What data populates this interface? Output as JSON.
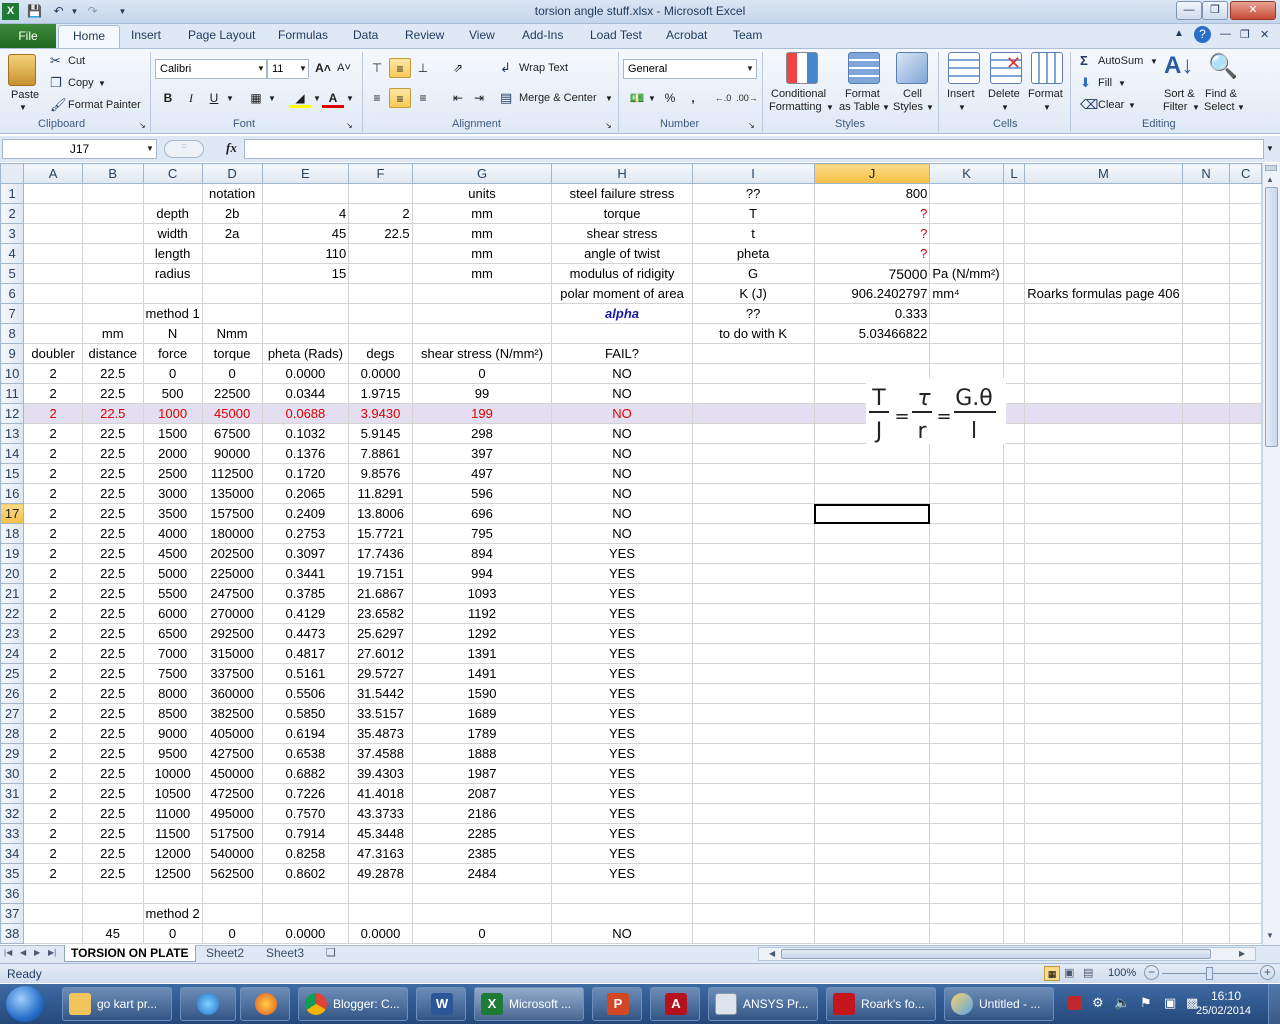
{
  "window": {
    "title": "torsion angle stuff.xlsx - Microsoft Excel"
  },
  "ribbon": {
    "file_tab": "File",
    "tabs": [
      "Home",
      "Insert",
      "Page Layout",
      "Formulas",
      "Data",
      "Review",
      "View",
      "Add-Ins",
      "Load Test",
      "Acrobat",
      "Team"
    ],
    "clipboard": {
      "paste": "Paste",
      "cut": "Cut",
      "copy": "Copy",
      "format_painter": "Format Painter",
      "label": "Clipboard"
    },
    "font": {
      "name": "Calibri",
      "size": "11",
      "label": "Font",
      "bold": "B",
      "italic": "I",
      "underline": "U"
    },
    "alignment": {
      "wrap_text": "Wrap Text",
      "merge_center": "Merge & Center",
      "label": "Alignment"
    },
    "number": {
      "format": "General",
      "label": "Number",
      "percent": "%",
      "comma": ","
    },
    "styles": {
      "conditional": "Conditional",
      "formatting": "Formatting",
      "format": "Format",
      "as_table": "as Table",
      "cell": "Cell",
      "cell_styles": "Styles",
      "label": "Styles"
    },
    "cells": {
      "insert": "Insert",
      "delete": "Delete",
      "format": "Format",
      "label": "Cells"
    },
    "editing": {
      "autosum": "AutoSum",
      "fill": "Fill",
      "clear": "Clear",
      "sort": "Sort &",
      "filter": "Filter",
      "find": "Find &",
      "select": "Select",
      "label": "Editing"
    }
  },
  "formula_bar": {
    "name_box": "J17",
    "fx": "fx",
    "content": ""
  },
  "columns": [
    "A",
    "B",
    "C",
    "D",
    "E",
    "F",
    "G",
    "H",
    "I",
    "J",
    "K",
    "L",
    "M",
    "N",
    "C"
  ],
  "selected_column": "J",
  "selected_row": "17",
  "highlight_row": 12,
  "rows": [
    {
      "n": "1",
      "cells": {
        "D": "notation",
        "G": "units",
        "H": "steel failure stress",
        "I": "??",
        "J": "800"
      }
    },
    {
      "n": "2",
      "cells": {
        "C": "depth",
        "D": "2b",
        "E": "4",
        "F": "2",
        "G": "mm",
        "H": "torque",
        "I": "T",
        "J": "?"
      }
    },
    {
      "n": "3",
      "cells": {
        "C": "width",
        "D": "2a",
        "E": "45",
        "F": "22.5",
        "G": "mm",
        "H": "shear stress",
        "I": "t",
        "J": "?"
      }
    },
    {
      "n": "4",
      "cells": {
        "C": "length",
        "E": "110",
        "G": "mm",
        "H": "angle of twist",
        "I": "pheta",
        "J": "?"
      }
    },
    {
      "n": "5",
      "cells": {
        "C": "radius",
        "E": "15",
        "G": "mm",
        "H": "modulus of ridigity",
        "I": "G",
        "J": "75000",
        "K": "Pa (N/mm²)"
      }
    },
    {
      "n": "6",
      "cells": {
        "H": "polar  moment of area",
        "I": "K (J)",
        "J": "906.2402797",
        "K": "mm⁴",
        "M": "Roarks formulas page 406"
      }
    },
    {
      "n": "7",
      "cells": {
        "C": "method 1",
        "H": "alpha",
        "I": "??",
        "J": "0.333"
      }
    },
    {
      "n": "8",
      "cells": {
        "B": "mm",
        "C": "N",
        "D": "Nmm",
        "I": "to do with K",
        "J": "5.03466822"
      }
    },
    {
      "n": "9",
      "cells": {
        "A": "doubler",
        "B": "distance",
        "C": "force",
        "D": "torque",
        "E": "pheta (Rads)",
        "F": "degs",
        "G": "shear stress (N/mm²)",
        "H": "FAIL?"
      }
    },
    {
      "n": "10",
      "cells": {
        "A": "2",
        "B": "22.5",
        "C": "0",
        "D": "0",
        "E": "0.0000",
        "F": "0.0000",
        "G": "0",
        "H": "NO"
      }
    },
    {
      "n": "11",
      "cells": {
        "A": "2",
        "B": "22.5",
        "C": "500",
        "D": "22500",
        "E": "0.0344",
        "F": "1.9715",
        "G": "99",
        "H": "NO"
      }
    },
    {
      "n": "12",
      "cells": {
        "A": "2",
        "B": "22.5",
        "C": "1000",
        "D": "45000",
        "E": "0.0688",
        "F": "3.9430",
        "G": "199",
        "H": "NO"
      }
    },
    {
      "n": "13",
      "cells": {
        "A": "2",
        "B": "22.5",
        "C": "1500",
        "D": "67500",
        "E": "0.1032",
        "F": "5.9145",
        "G": "298",
        "H": "NO"
      }
    },
    {
      "n": "14",
      "cells": {
        "A": "2",
        "B": "22.5",
        "C": "2000",
        "D": "90000",
        "E": "0.1376",
        "F": "7.8861",
        "G": "397",
        "H": "NO"
      }
    },
    {
      "n": "15",
      "cells": {
        "A": "2",
        "B": "22.5",
        "C": "2500",
        "D": "112500",
        "E": "0.1720",
        "F": "9.8576",
        "G": "497",
        "H": "NO"
      }
    },
    {
      "n": "16",
      "cells": {
        "A": "2",
        "B": "22.5",
        "C": "3000",
        "D": "135000",
        "E": "0.2065",
        "F": "11.8291",
        "G": "596",
        "H": "NO"
      }
    },
    {
      "n": "17",
      "cells": {
        "A": "2",
        "B": "22.5",
        "C": "3500",
        "D": "157500",
        "E": "0.2409",
        "F": "13.8006",
        "G": "696",
        "H": "NO"
      }
    },
    {
      "n": "18",
      "cells": {
        "A": "2",
        "B": "22.5",
        "C": "4000",
        "D": "180000",
        "E": "0.2753",
        "F": "15.7721",
        "G": "795",
        "H": "NO"
      }
    },
    {
      "n": "19",
      "cells": {
        "A": "2",
        "B": "22.5",
        "C": "4500",
        "D": "202500",
        "E": "0.3097",
        "F": "17.7436",
        "G": "894",
        "H": "YES"
      }
    },
    {
      "n": "20",
      "cells": {
        "A": "2",
        "B": "22.5",
        "C": "5000",
        "D": "225000",
        "E": "0.3441",
        "F": "19.7151",
        "G": "994",
        "H": "YES"
      }
    },
    {
      "n": "21",
      "cells": {
        "A": "2",
        "B": "22.5",
        "C": "5500",
        "D": "247500",
        "E": "0.3785",
        "F": "21.6867",
        "G": "1093",
        "H": "YES"
      }
    },
    {
      "n": "22",
      "cells": {
        "A": "2",
        "B": "22.5",
        "C": "6000",
        "D": "270000",
        "E": "0.4129",
        "F": "23.6582",
        "G": "1192",
        "H": "YES"
      }
    },
    {
      "n": "23",
      "cells": {
        "A": "2",
        "B": "22.5",
        "C": "6500",
        "D": "292500",
        "E": "0.4473",
        "F": "25.6297",
        "G": "1292",
        "H": "YES"
      }
    },
    {
      "n": "24",
      "cells": {
        "A": "2",
        "B": "22.5",
        "C": "7000",
        "D": "315000",
        "E": "0.4817",
        "F": "27.6012",
        "G": "1391",
        "H": "YES"
      }
    },
    {
      "n": "25",
      "cells": {
        "A": "2",
        "B": "22.5",
        "C": "7500",
        "D": "337500",
        "E": "0.5161",
        "F": "29.5727",
        "G": "1491",
        "H": "YES"
      }
    },
    {
      "n": "26",
      "cells": {
        "A": "2",
        "B": "22.5",
        "C": "8000",
        "D": "360000",
        "E": "0.5506",
        "F": "31.5442",
        "G": "1590",
        "H": "YES"
      }
    },
    {
      "n": "27",
      "cells": {
        "A": "2",
        "B": "22.5",
        "C": "8500",
        "D": "382500",
        "E": "0.5850",
        "F": "33.5157",
        "G": "1689",
        "H": "YES"
      }
    },
    {
      "n": "28",
      "cells": {
        "A": "2",
        "B": "22.5",
        "C": "9000",
        "D": "405000",
        "E": "0.6194",
        "F": "35.4873",
        "G": "1789",
        "H": "YES"
      }
    },
    {
      "n": "29",
      "cells": {
        "A": "2",
        "B": "22.5",
        "C": "9500",
        "D": "427500",
        "E": "0.6538",
        "F": "37.4588",
        "G": "1888",
        "H": "YES"
      }
    },
    {
      "n": "30",
      "cells": {
        "A": "2",
        "B": "22.5",
        "C": "10000",
        "D": "450000",
        "E": "0.6882",
        "F": "39.4303",
        "G": "1987",
        "H": "YES"
      }
    },
    {
      "n": "31",
      "cells": {
        "A": "2",
        "B": "22.5",
        "C": "10500",
        "D": "472500",
        "E": "0.7226",
        "F": "41.4018",
        "G": "2087",
        "H": "YES"
      }
    },
    {
      "n": "32",
      "cells": {
        "A": "2",
        "B": "22.5",
        "C": "11000",
        "D": "495000",
        "E": "0.7570",
        "F": "43.3733",
        "G": "2186",
        "H": "YES"
      }
    },
    {
      "n": "33",
      "cells": {
        "A": "2",
        "B": "22.5",
        "C": "11500",
        "D": "517500",
        "E": "0.7914",
        "F": "45.3448",
        "G": "2285",
        "H": "YES"
      }
    },
    {
      "n": "34",
      "cells": {
        "A": "2",
        "B": "22.5",
        "C": "12000",
        "D": "540000",
        "E": "0.8258",
        "F": "47.3163",
        "G": "2385",
        "H": "YES"
      }
    },
    {
      "n": "35",
      "cells": {
        "A": "2",
        "B": "22.5",
        "C": "12500",
        "D": "562500",
        "E": "0.8602",
        "F": "49.2878",
        "G": "2484",
        "H": "YES"
      }
    },
    {
      "n": "36",
      "cells": {}
    },
    {
      "n": "37",
      "cells": {
        "C": "method 2"
      }
    },
    {
      "n": "38",
      "cells": {
        "B": "45",
        "C": "0",
        "D": "0",
        "E": "0.0000",
        "F": "0.0000",
        "G": "0",
        "H": "NO"
      }
    }
  ],
  "formula_image": {
    "T": "T",
    "J": "J",
    "tau": "τ",
    "r": "r",
    "G_theta": "G.θ",
    "l": "l",
    "eq": "="
  },
  "sheet_tabs": [
    "TORSION ON PLATE",
    "Sheet2",
    "Sheet3"
  ],
  "active_sheet": "TORSION ON PLATE",
  "status": {
    "ready": "Ready",
    "zoom": "100%"
  },
  "taskbar": {
    "items": [
      "go kart pr...",
      "",
      "",
      "Blogger: C...",
      "",
      "Microsoft ...",
      "",
      "",
      "ANSYS Pr...",
      "Roark's fo...",
      "Untitled - ..."
    ],
    "time": "16:10",
    "date": "25/02/2014"
  },
  "colors": {
    "accent_red": "#e00000",
    "alpha_blue": "#1a1aa6",
    "highlight_row": "#e4dff0",
    "selected_header": "#f6c046"
  }
}
